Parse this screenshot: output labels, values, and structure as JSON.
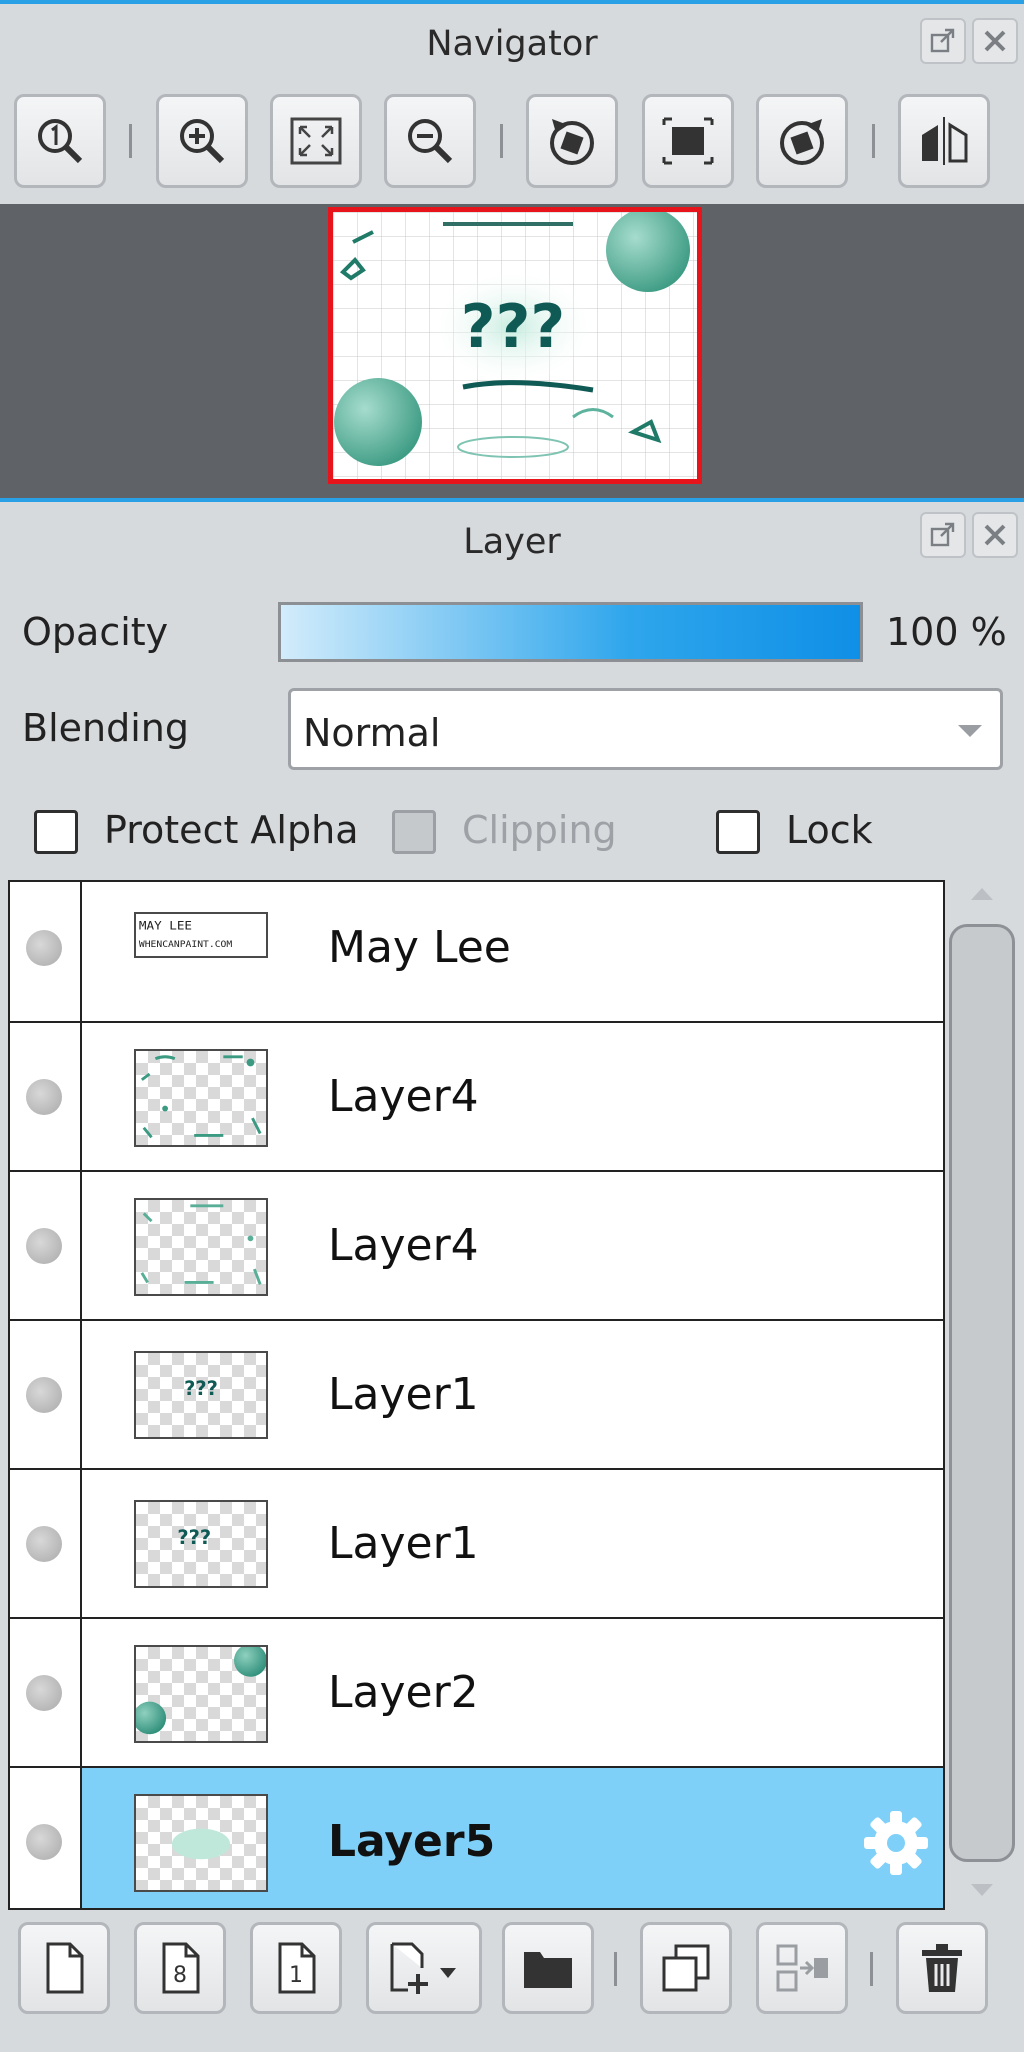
{
  "navigator": {
    "title": "Navigator",
    "toolbar": [
      "zoom-actual-size",
      "zoom-in",
      "fit-to-window",
      "zoom-out",
      "rotate-left",
      "reset-rotation",
      "rotate-right",
      "flip-horizontal"
    ]
  },
  "layer_panel": {
    "title": "Layer",
    "opacity_label": "Opacity",
    "opacity_value": "100 %",
    "blending_label": "Blending",
    "blending_value": "Normal",
    "protect_alpha_label": "Protect Alpha",
    "clipping_label": "Clipping",
    "lock_label": "Lock",
    "layers": [
      {
        "name": "May Lee",
        "selected": false
      },
      {
        "name": "Layer4",
        "selected": false
      },
      {
        "name": "Layer4",
        "selected": false
      },
      {
        "name": "Layer1",
        "selected": false
      },
      {
        "name": "Layer1",
        "selected": false
      },
      {
        "name": "Layer2",
        "selected": false
      },
      {
        "name": "Layer5",
        "selected": true
      }
    ],
    "thumbnail_texts": {
      "may_lee_line1": "MAY LEE",
      "may_lee_line2": "WHENCANPAINT.COM",
      "question": "???"
    },
    "bottom_toolbar": [
      "new-layer",
      "new-8bit-layer",
      "new-1bit-layer",
      "add-layer-menu",
      "new-folder",
      "duplicate-layer",
      "merge-down",
      "delete-layer"
    ]
  },
  "colors": {
    "accent": "#2aa0e6",
    "selected_row": "#7fd0f8",
    "preview_border": "#e8141c",
    "teal": "#2f8f7a"
  }
}
